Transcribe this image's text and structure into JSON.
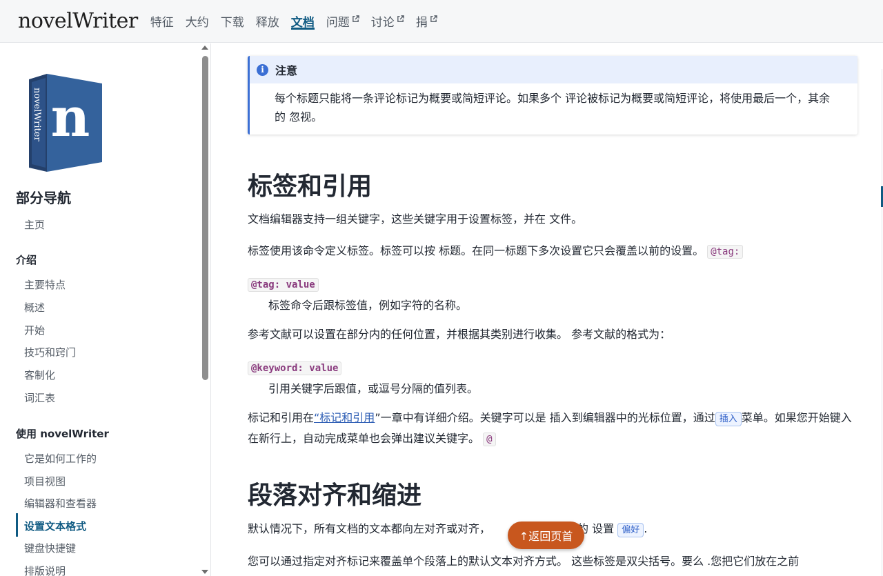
{
  "brand": "novelWriter",
  "nav": [
    {
      "label": "特征",
      "external": false,
      "active": false
    },
    {
      "label": "大约",
      "external": false,
      "active": false
    },
    {
      "label": "下载",
      "external": false,
      "active": false
    },
    {
      "label": "释放",
      "external": false,
      "active": false
    },
    {
      "label": "文档",
      "external": false,
      "active": true
    },
    {
      "label": "问题",
      "external": true,
      "active": false
    },
    {
      "label": "讨论",
      "external": true,
      "active": false
    },
    {
      "label": "捐",
      "external": true,
      "active": false
    }
  ],
  "sidebar": {
    "logo_text": "novelWriter",
    "section_title": "部分导航",
    "home": "主页",
    "intro_head": "介绍",
    "intro_items": [
      "主要特点",
      "概述",
      "开始",
      "技巧和窍门",
      "客制化",
      "词汇表"
    ],
    "use_head": "使用 novelWriter",
    "use_items": [
      "它是如何工作的",
      "项目视图",
      "编辑器和查看器",
      "设置文本格式",
      "键盘快捷键",
      "排版说明"
    ],
    "current": "设置文本格式"
  },
  "note": {
    "title": "注意",
    "body": "每个标题只能将一条评论标记为概要或简短评论。如果多个 评论被标记为概要或简短评论，将使用最后一个，其余的 忽视。"
  },
  "section1": {
    "heading": "标签和引用",
    "p1": "文档编辑器支持一组关键字，这些关键字用于设置标签，并在 文件。",
    "p2_text": "标签使用该命令定义标签。标签可以按 标题。在同一标题下多次设置它只会覆盖以前的设置。",
    "p2_code": "@tag:",
    "dt1": "@tag: value",
    "dd1": "标签命令后跟标签值，例如字符的名称。",
    "p3": "参考文献可以设置在部分内的任何位置，并根据其类别进行收集。 参考文献的格式为：",
    "dt2": "@keyword: value",
    "dd2": "引用关键字后跟值，或逗号分隔的值列表。",
    "p4_a": "标记和引用在",
    "p4_link": "“标记和引用",
    "p4_b": "”一章中有详细介绍。关键字可以是 插入到编辑器中的光标位置，通过",
    "p4_gui": "插入",
    "p4_c": "菜单。如果您开始键入 在新行上，自动完成菜单也会弹出建议关键字。",
    "p4_code": "@"
  },
  "section2": {
    "heading": "段落对齐和缩进",
    "p1_a": "默认情况下，所有文档的文本都向左对齐或对齐，",
    "p1_b": "您的 设置",
    "p1_gui": "偏好",
    "p1_c": ".",
    "p2": "您可以通过指定对齐标记来覆盖单个段落上的默认文本对齐方式。 这些标签是双尖括号。要么 .您把它们放在之前"
  },
  "back_to_top": "↑返回页首",
  "colors": {
    "accent": "#0f5a82",
    "note_border": "#3b6fd4",
    "back_top": "#c8571e"
  }
}
